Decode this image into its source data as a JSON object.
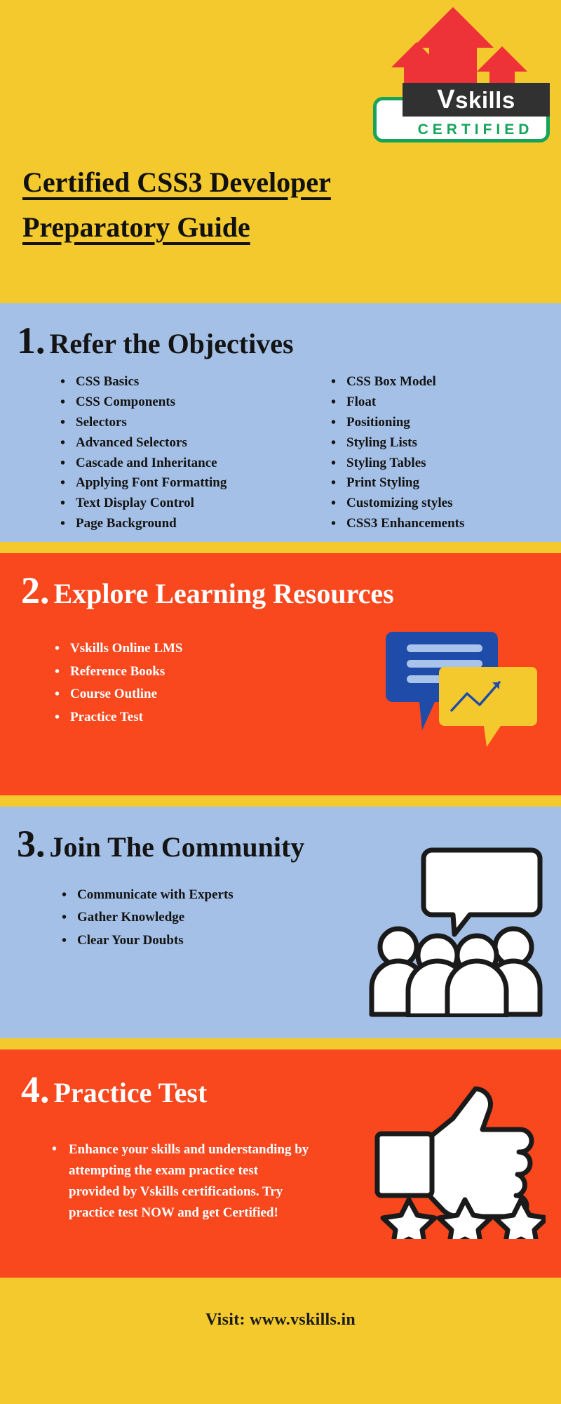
{
  "brand": {
    "logo_mark": "red-upward-arrows",
    "name_v": "V",
    "name_skills": "skills",
    "certified": "CERTIFIED",
    "colors": {
      "yellow": "#f3c92e",
      "blue": "#a4c0e6",
      "orange": "#f9471e",
      "green": "#16a35a",
      "red": "#ee3338",
      "dark": "#313131"
    }
  },
  "header": {
    "title_line1": "Certified CSS3 Developer",
    "title_line2": "Preparatory Guide"
  },
  "sections": [
    {
      "number": "1",
      "dot": ".",
      "title": "Refer the Objectives",
      "column_left": [
        "CSS Basics",
        "CSS Components",
        "Selectors",
        "Advanced Selectors",
        "Cascade and Inheritance",
        "Applying Font Formatting",
        "Text Display Control",
        "Page Background"
      ],
      "column_right": [
        "CSS Box Model",
        "Float",
        "Positioning",
        "Styling Lists",
        "Styling Tables",
        "Print Styling",
        "Customizing styles",
        "CSS3 Enhancements"
      ]
    },
    {
      "number": "2",
      "dot": ".",
      "title": "Explore Learning Resources",
      "items": [
        "Vskills Online LMS",
        "Reference Books",
        "Course Outline",
        "Practice Test"
      ],
      "illustration": "speech-bubbles-icon"
    },
    {
      "number": "3",
      "dot": ".",
      "title": "Join The Community",
      "items": [
        "Communicate with Experts",
        "Gather Knowledge",
        "Clear Your Doubts"
      ],
      "illustration": "people-group-icon"
    },
    {
      "number": "4",
      "dot": ".",
      "title": "Practice Test",
      "items": [
        "Enhance your skills and understanding by attempting the exam practice test provided by Vskills certifications. Try practice test NOW and get Certified!"
      ],
      "illustration": "thumbs-up-stars-icon"
    }
  ],
  "footer": {
    "visit_text": "Visit: www.vskills.in"
  }
}
